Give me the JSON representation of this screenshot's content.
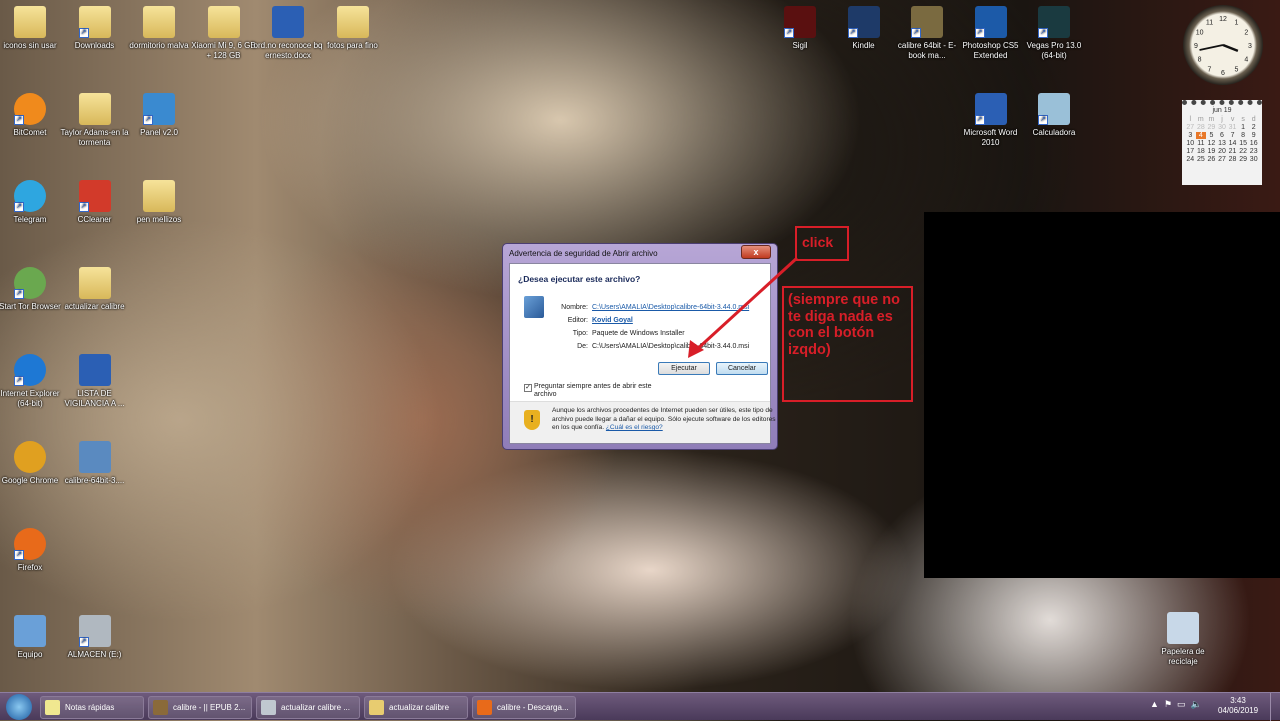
{
  "desktop_icons": [
    {
      "label": "iconos sin usar",
      "type": "folder",
      "col": 0,
      "row": 0,
      "side": "left"
    },
    {
      "label": "Downloads",
      "type": "folder",
      "col": 1,
      "row": 0,
      "side": "left",
      "shortcut": true
    },
    {
      "label": "dormitorio malva",
      "type": "folder",
      "col": 2,
      "row": 0,
      "side": "left"
    },
    {
      "label": "Xiaomi Mi 9, 6 GB + 128 GB",
      "type": "folder",
      "col": 3,
      "row": 0,
      "side": "left"
    },
    {
      "label": "ord.no reconoce bq ernesto.docx",
      "type": "word",
      "col": 4,
      "row": 0,
      "side": "left"
    },
    {
      "label": "fotos para fino",
      "type": "folder",
      "col": 5,
      "row": 0,
      "side": "left"
    },
    {
      "label": "BitComet",
      "type": "bitcomet",
      "col": 0,
      "row": 1,
      "side": "left",
      "shortcut": true
    },
    {
      "label": "Taylor Adams-en la tormenta",
      "type": "folder",
      "col": 1,
      "row": 1,
      "side": "left"
    },
    {
      "label": "Panel v2.0",
      "type": "panel",
      "col": 2,
      "row": 1,
      "side": "left",
      "shortcut": true
    },
    {
      "label": "Telegram",
      "type": "telegram",
      "col": 0,
      "row": 2,
      "side": "left",
      "shortcut": true
    },
    {
      "label": "CCleaner",
      "type": "ccleaner",
      "col": 1,
      "row": 2,
      "side": "left",
      "shortcut": true
    },
    {
      "label": "pen mellizos",
      "type": "folder",
      "col": 2,
      "row": 2,
      "side": "left"
    },
    {
      "label": "Start Tor Browser",
      "type": "tor",
      "col": 0,
      "row": 3,
      "side": "left",
      "shortcut": true
    },
    {
      "label": "actualizar calibre",
      "type": "folder",
      "col": 1,
      "row": 3,
      "side": "left"
    },
    {
      "label": "Internet Explorer (64-bit)",
      "type": "ie",
      "col": 0,
      "row": 4,
      "side": "left",
      "shortcut": true
    },
    {
      "label": "LISTA DE VIGILANCIA A ...",
      "type": "word",
      "col": 1,
      "row": 4,
      "side": "left"
    },
    {
      "label": "Google Chrome",
      "type": "chrome",
      "col": 0,
      "row": 5,
      "side": "left"
    },
    {
      "label": "calibre-64bit-3....",
      "type": "installer",
      "col": 1,
      "row": 5,
      "side": "left"
    },
    {
      "label": "Firefox",
      "type": "firefox",
      "col": 0,
      "row": 6,
      "side": "left",
      "shortcut": true
    },
    {
      "label": "Equipo",
      "type": "computer",
      "col": 0,
      "row": 7,
      "side": "left"
    },
    {
      "label": "ALMACEN (E:)",
      "type": "drive",
      "col": 1,
      "row": 7,
      "side": "left",
      "shortcut": true
    },
    {
      "label": "Sigil",
      "type": "sigil",
      "col": 0,
      "row": 0,
      "side": "right",
      "shortcut": true
    },
    {
      "label": "Kindle",
      "type": "kindle",
      "col": 1,
      "row": 0,
      "side": "right",
      "shortcut": true
    },
    {
      "label": "calibre 64bit - E-book ma...",
      "type": "calibre",
      "col": 2,
      "row": 0,
      "side": "right",
      "shortcut": true
    },
    {
      "label": "Photoshop CS5 Extended",
      "type": "photoshop",
      "col": 3,
      "row": 0,
      "side": "right",
      "shortcut": true
    },
    {
      "label": "Vegas Pro 13.0 (64-bit)",
      "type": "vegas",
      "col": 4,
      "row": 0,
      "side": "right",
      "shortcut": true
    },
    {
      "label": "Microsoft Word 2010",
      "type": "word",
      "col": 3,
      "row": 1,
      "side": "right",
      "shortcut": true
    },
    {
      "label": "Calculadora",
      "type": "calc",
      "col": 4,
      "row": 1,
      "side": "right",
      "shortcut": true
    },
    {
      "label": "Papelera de reciclaje",
      "type": "recycle",
      "col": 6,
      "row": 7,
      "side": "right"
    }
  ],
  "icon_colors": {
    "folder": "#e8cc70",
    "word": "#2b5fb4",
    "bitcomet": "#f08a1c",
    "panel": "#3a8ad0",
    "telegram": "#2ea6e0",
    "ccleaner": "#d23a2a",
    "tor": "#6aa84f",
    "ie": "#1e78d4",
    "chrome": "#e0a020",
    "installer": "#5a8ac0",
    "firefox": "#e86a1a",
    "computer": "#6aa0d8",
    "drive": "#b0b8c0",
    "sigil": "#5a1010",
    "kindle": "#1e3a68",
    "calibre": "#7a6a40",
    "photoshop": "#1c5aa8",
    "vegas": "#1a3a40",
    "calc": "#9ac0d8",
    "recycle": "#c8d8e8"
  },
  "dialog": {
    "title": "Advertencia de seguridad de Abrir archivo",
    "close": "x",
    "question": "¿Desea ejecutar este archivo?",
    "fields": [
      {
        "key": "Nombre:",
        "value": "C:\\Users\\AMALIA\\Desktop\\calibre-64bit-3.44.0.msi",
        "link": true
      },
      {
        "key": "Editor:",
        "value": "Kovid Goyal",
        "link": true
      },
      {
        "key": "Tipo:",
        "value": "Paquete de Windows Installer",
        "link": false
      },
      {
        "key": "De:",
        "value": "C:\\Users\\AMALIA\\Desktop\\calibre-64bit-3.44.0.msi",
        "link": false
      }
    ],
    "run_button": "Ejecutar",
    "cancel_button": "Cancelar",
    "checkbox_label": "Preguntar siempre antes de abrir este archivo",
    "checkbox_checked": true,
    "warning_text": "Aunque los archivos procedentes de Internet pueden ser útiles, este tipo de archivo puede llegar a dañar el equipo. Sólo ejecute software de los editores en los que confía.",
    "risk_link": "¿Cuál es el riesgo?"
  },
  "annotations": {
    "click": "click",
    "note": "(siempre que no te diga nada es con el botón izqdo)",
    "color": "#d81e28"
  },
  "calendar": {
    "month": "jun 19",
    "weekdays": [
      "l",
      "m",
      "m",
      "j",
      "v",
      "s",
      "d"
    ],
    "weeks": [
      [
        "27",
        "28",
        "29",
        "30",
        "31",
        "1",
        "2"
      ],
      [
        "3",
        "4",
        "5",
        "6",
        "7",
        "8",
        "9"
      ],
      [
        "10",
        "11",
        "12",
        "13",
        "14",
        "15",
        "16"
      ],
      [
        "17",
        "18",
        "19",
        "20",
        "21",
        "22",
        "23"
      ],
      [
        "24",
        "25",
        "26",
        "27",
        "28",
        "29",
        "30"
      ]
    ],
    "today": "4"
  },
  "clock": {
    "hour": 3,
    "minute": 43
  },
  "taskbar": {
    "items": [
      {
        "label": "Notas rápidas",
        "color": "#f0e890"
      },
      {
        "label": "calibre - || EPUB 2...",
        "color": "#8a6a3a"
      },
      {
        "label": "actualizar calibre ...",
        "color": "#c0c8d0"
      },
      {
        "label": "actualizar calibre",
        "color": "#e8cc70"
      },
      {
        "label": "calibre - Descarga...",
        "color": "#e86a1a"
      }
    ],
    "time": "3:43",
    "date": "04/06/2019"
  }
}
